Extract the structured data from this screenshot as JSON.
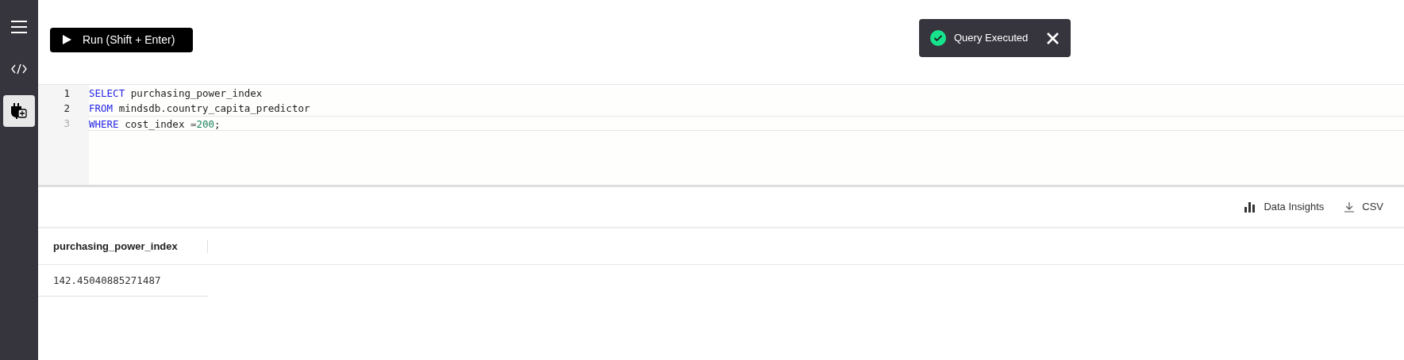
{
  "sidebar": {
    "items": [
      {
        "kind": "menu",
        "selected": false
      },
      {
        "kind": "code",
        "selected": false
      },
      {
        "kind": "plugin",
        "selected": true
      }
    ]
  },
  "toolbar": {
    "run_button": "Run (Shift + Enter)"
  },
  "toast": {
    "message": "Query Executed",
    "succeeded": true
  },
  "editor": {
    "lines": [
      {
        "number": "1",
        "active": false,
        "tokens": [
          {
            "kind": "keyword",
            "text": "SELECT"
          },
          {
            "kind": "plain",
            "text": " purchasing_power_index"
          }
        ]
      },
      {
        "number": "2",
        "active": false,
        "tokens": [
          {
            "kind": "keyword",
            "text": "FROM"
          },
          {
            "kind": "plain",
            "text": " mindsdb.country_capita_predictor"
          }
        ]
      },
      {
        "number": "3",
        "active": true,
        "tokens": [
          {
            "kind": "keyword",
            "text": "WHERE"
          },
          {
            "kind": "plain",
            "text": " cost_index "
          },
          {
            "kind": "operator",
            "text": "="
          },
          {
            "kind": "number",
            "text": "200"
          },
          {
            "kind": "plain",
            "text": ";"
          }
        ]
      }
    ]
  },
  "results": {
    "actions": [
      {
        "kind": "insights",
        "label": "Data Insights"
      },
      {
        "kind": "download",
        "label": "CSV"
      }
    ],
    "table": {
      "columns": [
        "purchasing_power_index"
      ],
      "rows": [
        [
          "142.45040885271487"
        ]
      ]
    }
  }
}
